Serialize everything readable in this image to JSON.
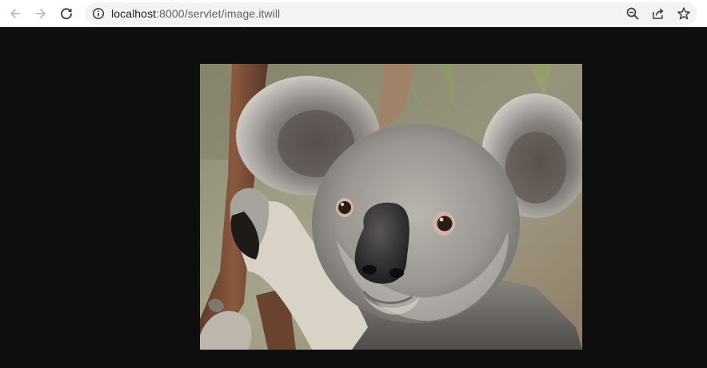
{
  "browser": {
    "back_icon": "arrow-left-icon",
    "forward_icon": "arrow-right-icon",
    "reload_icon": "reload-icon",
    "address": {
      "security_icon": "info-icon",
      "host": "localhost",
      "path": ":8000/servlet/image.itwill"
    },
    "actions": {
      "zoom_icon": "zoom-out-icon",
      "share_icon": "share-icon",
      "bookmark_icon": "star-icon"
    }
  },
  "page": {
    "background_color": "#0e0e0e",
    "image": {
      "subject": "koala photo",
      "alt": "image.itwill"
    }
  }
}
